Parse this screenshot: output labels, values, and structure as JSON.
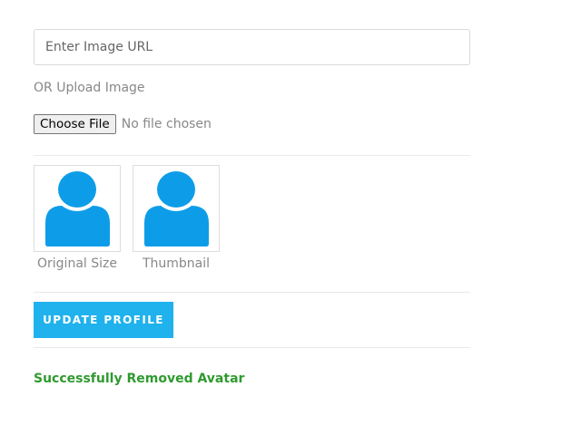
{
  "image_url_input": {
    "placeholder": "Enter Image URL",
    "value": ""
  },
  "upload": {
    "label": "OR Upload Image",
    "button_label": "Choose File",
    "status": "No file chosen"
  },
  "previews": [
    {
      "caption": "Original Size",
      "icon": "user-avatar-icon"
    },
    {
      "caption": "Thumbnail",
      "icon": "user-avatar-icon"
    }
  ],
  "update_button_label": "UPDATE PROFILE",
  "status_message": "Successfully Removed Avatar",
  "colors": {
    "accent": "#1fb2ec",
    "avatar": "#0d9de8",
    "success": "#2f9a2f"
  }
}
